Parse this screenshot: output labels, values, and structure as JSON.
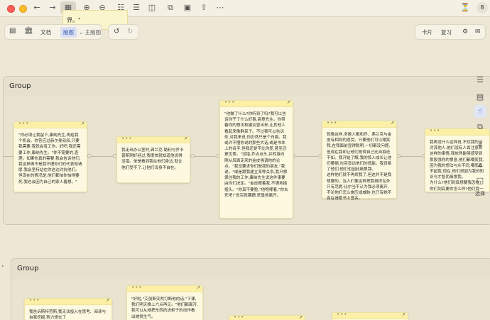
{
  "toolbar": {
    "icons": [
      "sidebar-toggle",
      "back",
      "forward",
      "grid-view",
      "zoom-in",
      "zoom-out",
      "table-view",
      "copy",
      "screenshot",
      "export",
      "share",
      "download",
      "more"
    ],
    "badge": "8"
  },
  "top_peek_text": "界。\"",
  "view_bar": {
    "doc_label": "文档",
    "outline_label": "脑图",
    "theme_label": "主脑图",
    "card_label": "卡片",
    "review_label": "复习"
  },
  "rail": {
    "select_label": "选择"
  },
  "groups": [
    {
      "title": "Group",
      "cards": [
        "\"你必须让我留下,康纳先生,再给我个机会。你答应过赫尔曼叔叔,只要我需要,我就会有工作。好吧,我还需要工作,康纳先生。\"你不需要的,查理。如果你真的需要,我会告诉他们,我这样做不是我不理你们的代表和请愿,我会坚持站在你这边对抗他们。但现在的情况是,他们都怕你怕得要死,我也会因为自己的家人着想。\"",
        "我走出办公室时,弗兰克·勒利与乔卡普斯刚好经过,我很快就知道他说得没错。单是看到我在他们身边,就让他们受不了,让他们浑身不自在。",
        "\"他做了什么?你听到了吗?我可以告诉你干了什么好事,高登先生。你带着你的想法和建议冒出来,让其他人看起来像群呆子。不过我可以告诉你,对我来说,你仍然只是个白痴。我或许不懂你说的那些大话,或是书本上的名字,但我还是不比你差,甚至还更优秀。\"没错,乔点点头,并转身向刚从后面走来的金皮强调他的论点。\"我没要求你们做我的朋友,\"我说。\"或是跟我建立某种关系,我只想保住我的工作,康纳先生说这件事要由你们决定。\"金皮瞪着我,不满地摇摇头。\"你真不要脸,\"他咆哮着,\"你去死吧!\"说完就蹒跚,笨重地离开。",
        "就像这样,多数人都和乔、弗兰克与金皮有相同的感受。只要他们可以嘲笑我,在我面前显得聪明,一切都没问题,但现在我却让他们觉得自己比自痴还不如。我开始了解,我的惊人成长让他们萎缩,也突显出他们的低能。我背叛了他们,他们也因此痛恨我。\n这样他们就不再烦我了,但这并不是我想要的。当人们像这样把我排挤在外,\n只有范妮·比尔当不认为我必须离开,不论他们怎么施压或威胁,也只有她不肯在请愿书上签名。",
        "我再没什么这样说,不仅我的话对其他人,他们没有人肯注意到这样的事情,我依然能够感受到那股强烈的恨意,他们都嘲笑我,因为我的想法与众不同,嘲而看不起我,现在,他们却因为我的知识与才智而痛恨我。\n为什么?他们到底想要我怎样?你们到底要你怎么样?他们竟一名,到底要我怎么样?"
      ]
    },
    {
      "title": "Group",
      "cards": [
        "我告诉斯特劳斯,我无法投入在思考、阅读与自我挖掘,努力想去了",
        "\"好啦,\"艾丽斯突然打断他的话,\"下课,我们明天晚上六点再见。\"他们都离开,我可以从她把东西扔进柜子的动作看出她很生气。",
        "",
        ""
      ]
    }
  ]
}
